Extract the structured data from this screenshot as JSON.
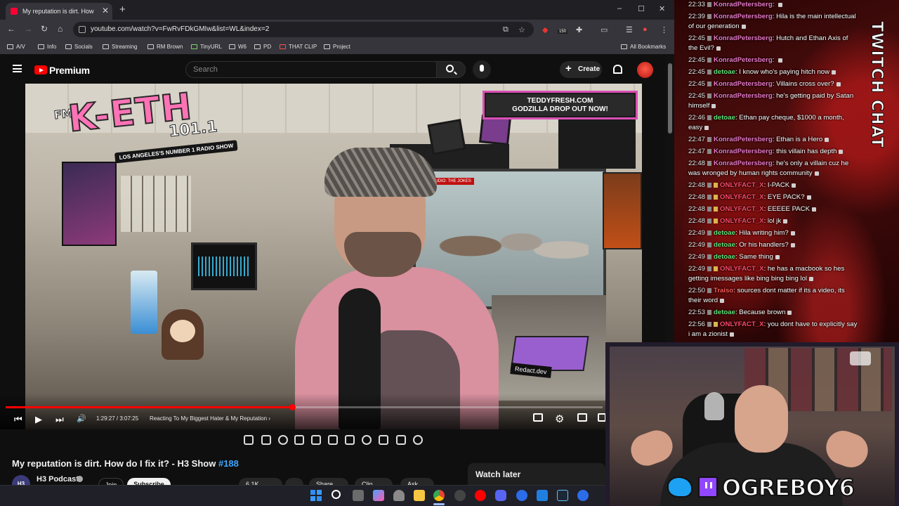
{
  "browser": {
    "tab_title": "My reputation is dirt. How",
    "tab_close": "✕",
    "new_tab": "+",
    "window_controls": [
      "–",
      "☐",
      "✕"
    ],
    "nav": {
      "back": "←",
      "forward": "→",
      "reload": "↻",
      "home": "⌂"
    },
    "url": "youtube.com/watch?v=FwRvFDkGMIw&list=WL&index=2",
    "extension_badge": "150",
    "bookmarks": [
      "A/V",
      "Info",
      "Socials",
      "Streaming",
      "RM Brown",
      "TinyURL",
      "W6",
      "PD",
      "THAT CLIP",
      "Project"
    ],
    "all_bookmarks": "All Bookmarks"
  },
  "youtube": {
    "brand": "Premium",
    "search_placeholder": "Search",
    "create_label": "Create",
    "create_plus": "+",
    "accent": "#ff0000"
  },
  "video": {
    "overlay": {
      "fm": "FM",
      "station": "K-ETH",
      "frequency": "101.1",
      "tagline": "LOS ANGELES'S NUMBER 1 RADIO SHOW",
      "studio_sign": "IN STUDIO: THE JOKES",
      "promo_line1": "TEDDYFRESH.COM",
      "promo_line2": "GODZILLA DROP OUT NOW!",
      "desk_label": "Redact.dev"
    },
    "progress": 0.48,
    "time": "1:29:27 / 3:07:25",
    "chapter": "Reacting To My Biggest Hater & My Reputation",
    "chapter_arrow": "›",
    "controls": {
      "prev": "⏮",
      "play": "▶",
      "next": "⏭",
      "volume": "🔊"
    }
  },
  "details": {
    "title": "My reputation is dirt. How do I fix it? - H3 Show",
    "episode": "#188",
    "channel": "H3 Podcast",
    "channel_initials": "H3",
    "join": "Join",
    "subscribe": "Subscribe",
    "likes": "6.1K",
    "share": "Share",
    "clip": "Clip",
    "ask": "Ask",
    "watch_later": "Watch later"
  },
  "chat": {
    "heading": "TWITCH CHAT",
    "messages": [
      {
        "time": "22:33",
        "user": "KonradPetersberg",
        "color": "#e879c8",
        "text": ""
      },
      {
        "time": "22:39",
        "user": "KonradPetersberg",
        "color": "#e879c8",
        "text": "Hila is the main intellectual of our generation"
      },
      {
        "time": "22:45",
        "user": "KonradPetersberg",
        "color": "#e879c8",
        "text": "Hutch and Ethan Axis of the Evil?"
      },
      {
        "time": "22:45",
        "user": "KonradPetersberg",
        "color": "#e879c8",
        "text": ""
      },
      {
        "time": "22:45",
        "user": "detoae",
        "color": "#5fe07a",
        "text": "I know who's paying hitch now"
      },
      {
        "time": "22:45",
        "user": "KonradPetersberg",
        "color": "#e879c8",
        "text": "Villains cross over?"
      },
      {
        "time": "22:45",
        "user": "KonradPetersberg",
        "color": "#e879c8",
        "text": "he's getting paid by Satan himself"
      },
      {
        "time": "22:46",
        "user": "detoae",
        "color": "#5fe07a",
        "text": "Ethan pay cheque, $1000 a month, easy"
      },
      {
        "time": "22:47",
        "user": "KonradPetersberg",
        "color": "#e879c8",
        "text": "Ethan is a Hero"
      },
      {
        "time": "22:47",
        "user": "KonradPetersberg",
        "color": "#e879c8",
        "text": "this villain has depth"
      },
      {
        "time": "22:48",
        "user": "KonradPetersberg",
        "color": "#e879c8",
        "text": "he's only a villain cuz he was wronged by human rights community"
      },
      {
        "time": "22:48",
        "user": "ONLYFACT_X",
        "color": "#ff4a6a",
        "text": "I-PACK"
      },
      {
        "time": "22:48",
        "user": "ONLYFACT_X",
        "color": "#ff4a6a",
        "text": "EYE PACK?"
      },
      {
        "time": "22:48",
        "user": "ONLYFACT_X",
        "color": "#ff4a6a",
        "text": "EEEEE PACK"
      },
      {
        "time": "22:48",
        "user": "ONLYFACT_X",
        "color": "#ff4a6a",
        "text": "lol jk"
      },
      {
        "time": "22:49",
        "user": "detoae",
        "color": "#5fe07a",
        "text": "Hila writing him?"
      },
      {
        "time": "22:49",
        "user": "detoae",
        "color": "#5fe07a",
        "text": "Or his handlers?"
      },
      {
        "time": "22:49",
        "user": "detoae",
        "color": "#5fe07a",
        "text": "Same thing"
      },
      {
        "time": "22:49",
        "user": "ONLYFACT_X",
        "color": "#ff4a6a",
        "text": "he has a macbook so hes getting imessages like bing bing bing lol"
      },
      {
        "time": "22:50",
        "user": "Traiso",
        "color": "#ff5b5b",
        "text": "sources dont matter if its a video, its their word"
      },
      {
        "time": "22:53",
        "user": "detoae",
        "color": "#5fe07a",
        "text": "Because brown"
      },
      {
        "time": "22:56",
        "user": "ONLYFACT_X",
        "color": "#ff4a6a",
        "text": "you dont have to explicitly say i am a zionist"
      }
    ]
  },
  "webcam": {
    "handle": "OGREBOY6"
  }
}
